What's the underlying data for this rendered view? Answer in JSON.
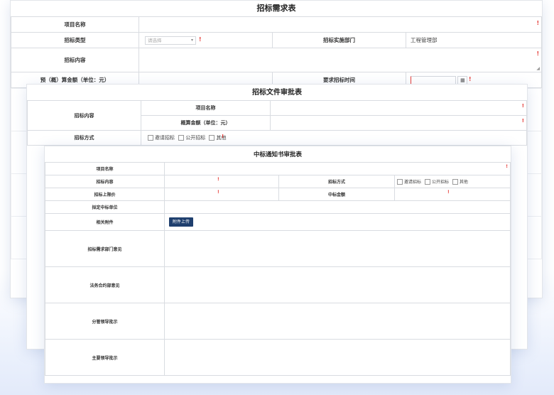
{
  "demand_form": {
    "title": "招标需求表",
    "project_name_label": "项目名称",
    "type_label": "招标类型",
    "type_select_placeholder": "请选择",
    "department_label": "招标实施部门",
    "department_value": "工程管理部",
    "content_label": "招标内容",
    "budget_label": "预（概）算金额（单位：元）",
    "required_time_label": "要求招标时间",
    "required_mark": "!"
  },
  "doc_approval_form": {
    "title": "招标文件审批表",
    "content_label": "招标内容",
    "project_name_label": "项目名称",
    "budget_label": "概算金额（单位：元）",
    "method_label": "招标方式",
    "method_options": [
      "邀请招标",
      "公开招标",
      "其他"
    ]
  },
  "award_notice_form": {
    "title": "中标通知书审批表",
    "project_name_label": "项目名称",
    "content_label": "招标内容",
    "method_label": "招标方式",
    "method_options": [
      "邀请招标",
      "公开招标",
      "其他"
    ],
    "ceiling_price_label": "招标上限价",
    "award_amount_label": "中标金额",
    "winner_label": "拟定中标单位",
    "attachment_label": "相关附件",
    "upload_button": "附件上传",
    "demand_dept_opinion_label": "招标需求部门意见",
    "legal_dept_opinion_label": "法务合约部意见",
    "supervising_leader_label": "分管领导批示",
    "chief_leader_label": "主要领导批示"
  },
  "icons": {
    "calendar": "calendar-icon",
    "dropdown": "chevron-down-icon",
    "resize": "resize-handle-icon"
  },
  "colors": {
    "required": "#e53935",
    "upload_button": "#1f3f6e",
    "border": "#d9dce1"
  }
}
